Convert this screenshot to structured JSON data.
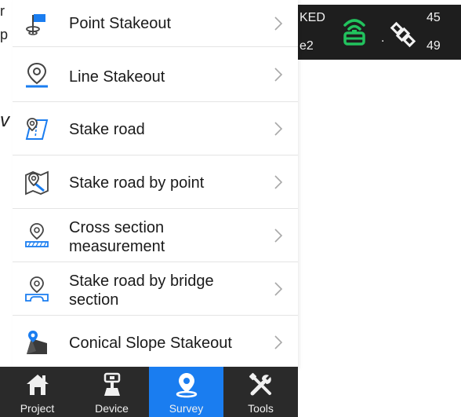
{
  "background_clip": {
    "line1": "r",
    "line2": "p",
    "line3": "v"
  },
  "status": {
    "text_top": "KED",
    "text_bottom": "e2",
    "sat_top": "45",
    "sat_bottom": "49",
    "dot": ".",
    "rtk_icon": "rtk-receiver-icon",
    "sat_icon": "satellite-icon",
    "rtk_color": "#22c35e"
  },
  "menu": {
    "items": [
      {
        "label": "Point Stakeout",
        "icon": "flag-pin-icon"
      },
      {
        "label": "Line Stakeout",
        "icon": "location-pin-icon"
      },
      {
        "label": "Stake road",
        "icon": "road-map-pin-icon"
      },
      {
        "label": "Stake road by point",
        "icon": "map-point-icon"
      },
      {
        "label": "Cross section\nmeasurement",
        "icon": "cross-section-icon"
      },
      {
        "label": "Stake road by bridge\nsection",
        "icon": "bridge-section-icon"
      },
      {
        "label": "Conical Slope Stakeout",
        "icon": "conical-slope-icon"
      }
    ]
  },
  "nav": {
    "tabs": [
      {
        "label": "Project",
        "icon": "home-icon",
        "active": false
      },
      {
        "label": "Device",
        "icon": "gnss-device-icon",
        "active": false
      },
      {
        "label": "Survey",
        "icon": "survey-pin-icon",
        "active": true
      },
      {
        "label": "Tools",
        "icon": "tools-icon",
        "active": false
      }
    ],
    "active_color": "#1a7df0"
  }
}
